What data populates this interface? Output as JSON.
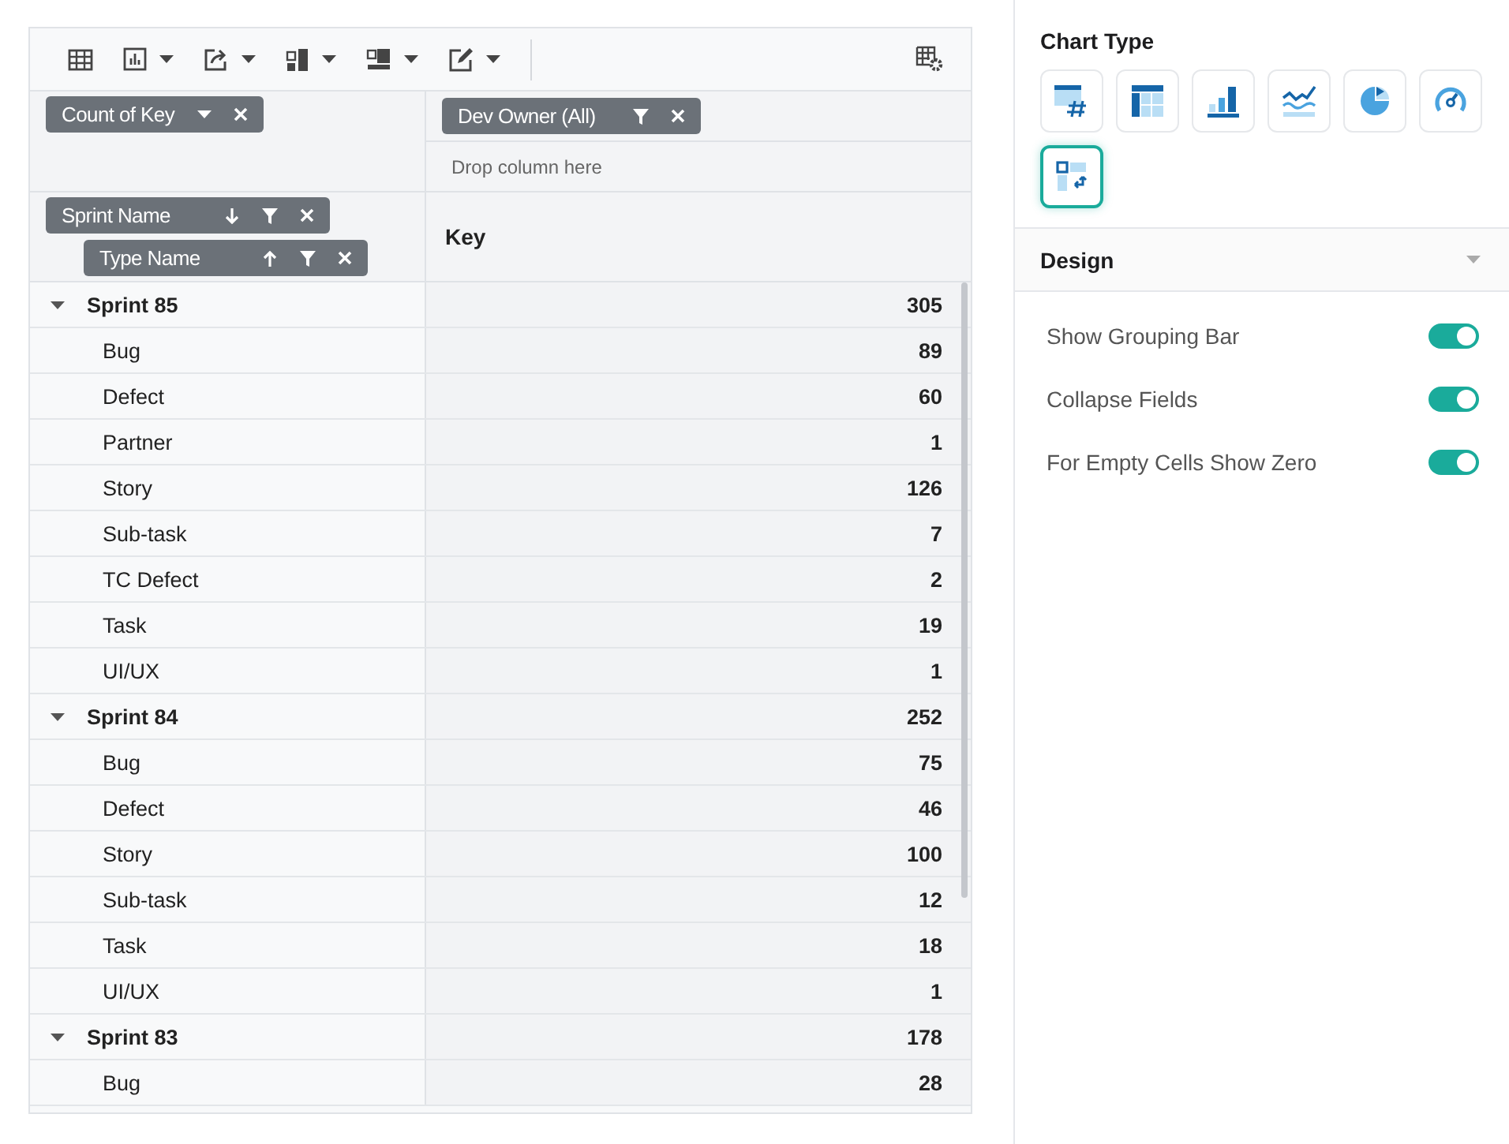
{
  "toolbar": {
    "items": [
      {
        "kind": "grid",
        "dropdown": false
      },
      {
        "kind": "chart",
        "dropdown": true
      },
      {
        "kind": "export",
        "dropdown": true
      },
      {
        "kind": "subtotals",
        "dropdown": true
      },
      {
        "kind": "totals",
        "dropdown": true
      },
      {
        "kind": "format",
        "dropdown": true
      }
    ]
  },
  "values_chip": {
    "label": "Count of Key"
  },
  "filter_chip": {
    "label": "Dev Owner (All)"
  },
  "column_drop": {
    "placeholder": "Drop column here"
  },
  "row_chips": [
    {
      "label": "Sprint Name",
      "ascending": false
    },
    {
      "label": "Type Name",
      "ascending": true
    }
  ],
  "value_header": "Key",
  "rows": [
    {
      "label": "Sprint 85",
      "value": "305",
      "expanded": true,
      "children": [
        {
          "label": "Bug",
          "value": "89"
        },
        {
          "label": "Defect",
          "value": "60"
        },
        {
          "label": "Partner",
          "value": "1"
        },
        {
          "label": "Story",
          "value": "126"
        },
        {
          "label": "Sub-task",
          "value": "7"
        },
        {
          "label": "TC Defect",
          "value": "2"
        },
        {
          "label": "Task",
          "value": "19"
        },
        {
          "label": "UI/UX",
          "value": "1"
        }
      ]
    },
    {
      "label": "Sprint 84",
      "value": "252",
      "expanded": true,
      "children": [
        {
          "label": "Bug",
          "value": "75"
        },
        {
          "label": "Defect",
          "value": "46"
        },
        {
          "label": "Story",
          "value": "100"
        },
        {
          "label": "Sub-task",
          "value": "12"
        },
        {
          "label": "Task",
          "value": "18"
        },
        {
          "label": "UI/UX",
          "value": "1"
        }
      ]
    },
    {
      "label": "Sprint 83",
      "value": "178",
      "expanded": true,
      "children": [
        {
          "label": "Bug",
          "value": "28"
        }
      ]
    }
  ],
  "chart_type": {
    "title": "Chart Type",
    "items": [
      {
        "kind": "number",
        "selected": false
      },
      {
        "kind": "table",
        "selected": false
      },
      {
        "kind": "bar",
        "selected": false
      },
      {
        "kind": "line",
        "selected": false
      },
      {
        "kind": "pie",
        "selected": false
      },
      {
        "kind": "gauge",
        "selected": false
      },
      {
        "kind": "pivot",
        "selected": true
      }
    ]
  },
  "design": {
    "title": "Design",
    "expanded": true,
    "toggles": [
      {
        "label": "Show Grouping Bar",
        "on": true
      },
      {
        "label": "Collapse Fields",
        "on": true
      },
      {
        "label": "For Empty Cells Show Zero",
        "on": true
      }
    ]
  }
}
